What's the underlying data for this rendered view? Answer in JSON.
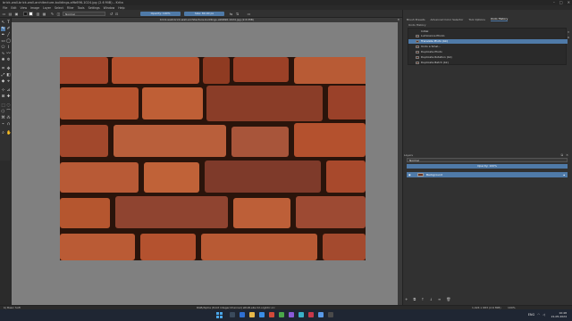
{
  "window": {
    "title": "brick-wall-brick-wall-architecture-buildings-a9b696-1024.jpg (2.6 MiB) – Krita",
    "min": "–",
    "max": "□",
    "close": "✕"
  },
  "menu": [
    "File",
    "Edit",
    "View",
    "Image",
    "Layer",
    "Select",
    "Filter",
    "Tools",
    "Settings",
    "Window",
    "Help"
  ],
  "toolbar": {
    "blend_mode": "Normal",
    "opacity": "Opacity: 100%",
    "size": "Size: 80.00 px",
    "colors": {
      "fg": "#1a1a1a",
      "bg": "#ffffff",
      "accent": "#4f7aa8"
    }
  },
  "document": {
    "tab_title": "brick-wall-brick-wall-architecture-buildings-a9b696-1024.jpg (2.6 MiB)"
  },
  "right_panel": {
    "tabs": [
      "Brush Presets",
      "Advanced Color Selector",
      "Tool Options",
      "Undo History"
    ],
    "active_tab": "Undo History",
    "history_items": [
      {
        "label": "Initial"
      },
      {
        "label": "Luminance Pholio"
      },
      {
        "label": "Translate Photo (bk)",
        "selected": true
      },
      {
        "label": "Undo a Smal..."
      },
      {
        "label": "Duplicate Photo"
      },
      {
        "label": "Duplicate Rotation (bk)"
      },
      {
        "label": "Duplicate Batch (bk)"
      }
    ]
  },
  "layers": {
    "title": "Layers",
    "blend_mode": "Normal",
    "opacity": "Opacity: 100%",
    "items": [
      {
        "name": "Background"
      }
    ]
  },
  "status": {
    "left": "b) Basic Soft",
    "middle": "RGB/Alpha (8-bit integer/channel) sRGB-elle-V2-srgbtrc.icc",
    "dims": "1,024 x 683 (2.6 MiB)",
    "zoom": "100%"
  },
  "taskbar": {
    "lang": "ENG",
    "time": "10:48",
    "date": "21-05-2024"
  }
}
